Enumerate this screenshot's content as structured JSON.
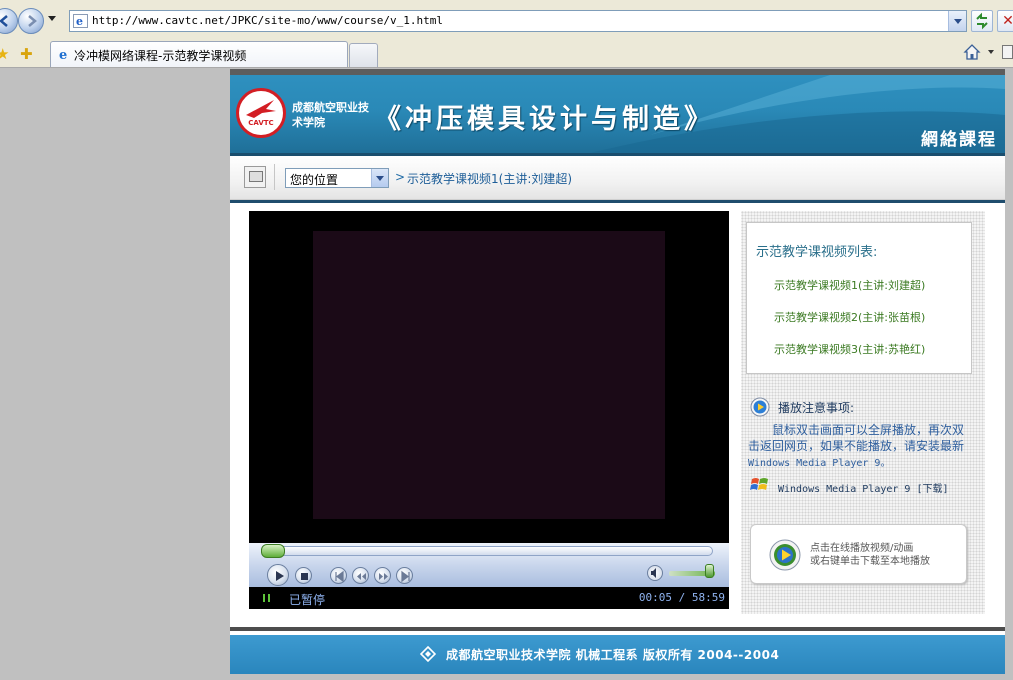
{
  "browser": {
    "url": "http://www.cavtc.net/JPKC/site-mo/www/course/v_1.html",
    "tab_title": "冷冲模网络课程-示范教学课视频"
  },
  "site": {
    "logo_text": "CAVTC",
    "school_name": "成都航空职业技术学院",
    "course_title": "《冲压模具设计与制造》",
    "net_course_label": "網絡課程"
  },
  "breadcrumb": {
    "location_select": "您的位置",
    "arrow": ">",
    "current": "示范教学课视频1(主讲:刘建超)"
  },
  "player": {
    "status": "已暂停",
    "time": "00:05 / 58:59",
    "progress": 0.0014,
    "volume": 0.8
  },
  "video_list": {
    "title": "示范教学课视频列表:",
    "items": [
      "示范教学课视频1(主讲:刘建超)",
      "示范教学课视频2(主讲:张苗根)",
      "示范教学课视频3(主讲:苏艳红)"
    ]
  },
  "notes": {
    "title": "播放注意事项:",
    "body": "鼠标双击画面可以全屏播放，再次双击返回网页，如果不能播放，请安装最新",
    "body_tail": "Windows Media Player 9。",
    "wmp_link": "Windows Media Player 9 [下载]"
  },
  "online_box": {
    "line1": "点击在线播放视频/动画",
    "line2": "或右键单击下载至本地播放"
  },
  "footer": {
    "copyright": "成都航空职业技术学院 机械工程系 版权所有   2004--2004"
  }
}
